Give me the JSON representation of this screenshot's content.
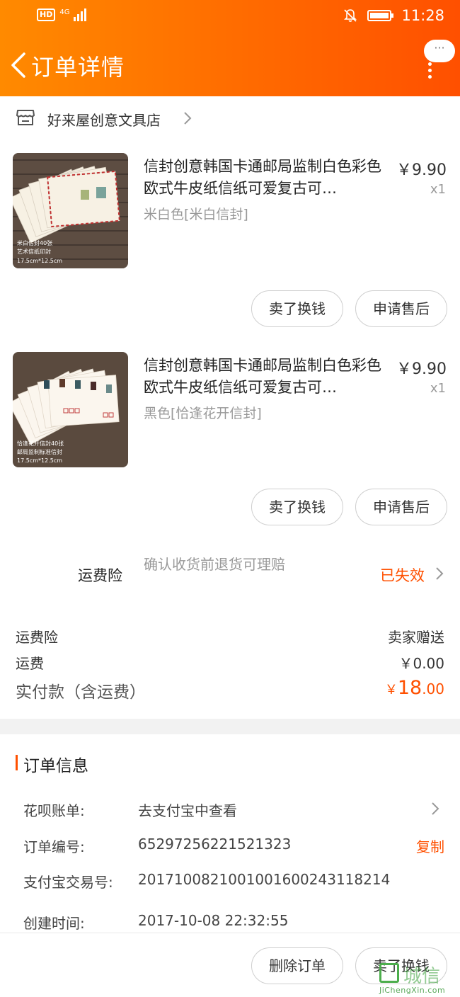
{
  "status_bar": {
    "hd_label": "HD",
    "signal_label": "4G",
    "time": "11:28",
    "battery_level": 0.9
  },
  "header": {
    "title": "订单详情",
    "more_label": "···"
  },
  "shop": {
    "name": "好来屋创意文具店"
  },
  "products": [
    {
      "title": "信封创意韩国卡通邮局监制白色彩色欧式牛皮纸信纸可爱复古可…",
      "sku": "米白色[米白信封]",
      "price": "￥9.90",
      "qty": "x1",
      "thumb_caption": "米白信封40张 艺术信纸印封 17.5cm*12.5cm",
      "actions": [
        "卖了换钱",
        "申请售后"
      ]
    },
    {
      "title": "信封创意韩国卡通邮局监制白色彩色欧式牛皮纸信纸可爱复古可…",
      "sku": "黑色[恰逢花开信封]",
      "price": "￥9.90",
      "qty": "x1",
      "thumb_caption": "恰逢花开信封40张 邮局监制标准信封 17.5cm*12.5cm",
      "actions": [
        "卖了换钱",
        "申请售后"
      ]
    }
  ],
  "insurance": {
    "label": "运费险",
    "desc": "确认收货前退货可理赔",
    "status": "已失效"
  },
  "fees": {
    "insurance_label": "运费险",
    "insurance_value": "卖家赠送",
    "shipping_label": "运费",
    "shipping_value": "￥0.00",
    "total_label": "实付款（含运费）",
    "total_currency": "￥",
    "total_int": "18",
    "total_dec": ".00"
  },
  "order_info": {
    "title": "订单信息",
    "rows": [
      {
        "label": "花呗账单:",
        "value": "去支付宝中查看"
      },
      {
        "label": "订单编号:",
        "value": "65297256221521323",
        "action": "复制"
      },
      {
        "label": "支付宝交易号:",
        "value": "2017100821001001600243118214"
      },
      {
        "label": "创建时间:",
        "value": "2017-10-08 22:32:55"
      }
    ]
  },
  "bottom_bar": {
    "actions": [
      "删除订单",
      "卖了换钱"
    ]
  },
  "watermark": {
    "text": "城信",
    "sub": "JiChengXin.com"
  },
  "colors": {
    "accent": "#ff5000",
    "header_start": "#ff8a00",
    "header_end": "#ff5000"
  }
}
